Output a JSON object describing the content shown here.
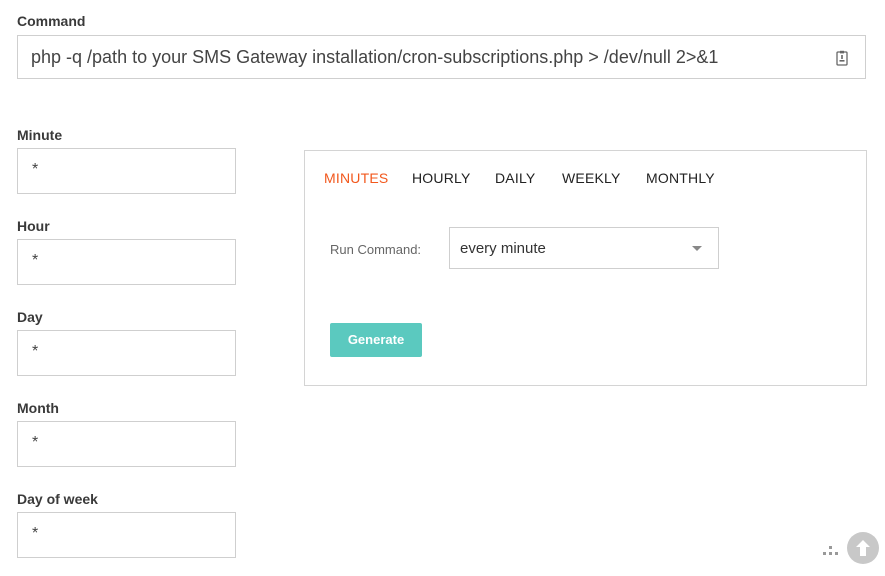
{
  "command": {
    "label": "Command",
    "value": "php -q /path to your SMS Gateway installation/cron-subscriptions.php > /dev/null 2>&1",
    "icon": "clipboard-icon"
  },
  "fields": [
    {
      "label": "Minute",
      "value": "*"
    },
    {
      "label": "Hour",
      "value": "*"
    },
    {
      "label": "Day",
      "value": "*"
    },
    {
      "label": "Month",
      "value": "*"
    },
    {
      "label": "Day of week",
      "value": "*"
    }
  ],
  "panel": {
    "tabs": [
      {
        "label": "MINUTES",
        "active": true
      },
      {
        "label": "HOURLY",
        "active": false
      },
      {
        "label": "DAILY",
        "active": false
      },
      {
        "label": "WEEKLY",
        "active": false
      },
      {
        "label": "MONTHLY",
        "active": false
      }
    ],
    "run_label": "Run Command:",
    "run_selected": "every minute",
    "generate_label": "Generate"
  },
  "colors": {
    "active_tab": "#f2581d",
    "generate_button": "#5bc9bf"
  },
  "icons": {
    "scroll_top": "arrow-up-icon",
    "grid": "dots-grid-icon"
  }
}
